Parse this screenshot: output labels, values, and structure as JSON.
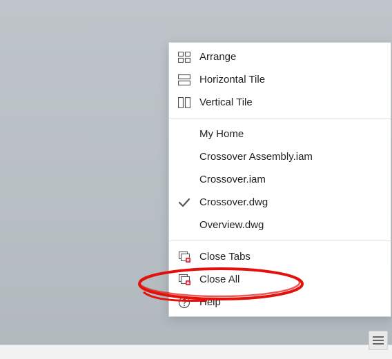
{
  "menu": {
    "group1": {
      "arrange": "Arrange",
      "htile": "Horizontal Tile",
      "vtile": "Vertical Tile"
    },
    "group2": {
      "myhome": "My Home",
      "crossover_asm": "Crossover Assembly.iam",
      "crossover_iam": "Crossover.iam",
      "crossover_dwg": "Crossover.dwg",
      "overview_dwg": "Overview.dwg"
    },
    "group3": {
      "close_tabs": "Close Tabs",
      "close_all": "Close All",
      "help": "Help"
    }
  }
}
